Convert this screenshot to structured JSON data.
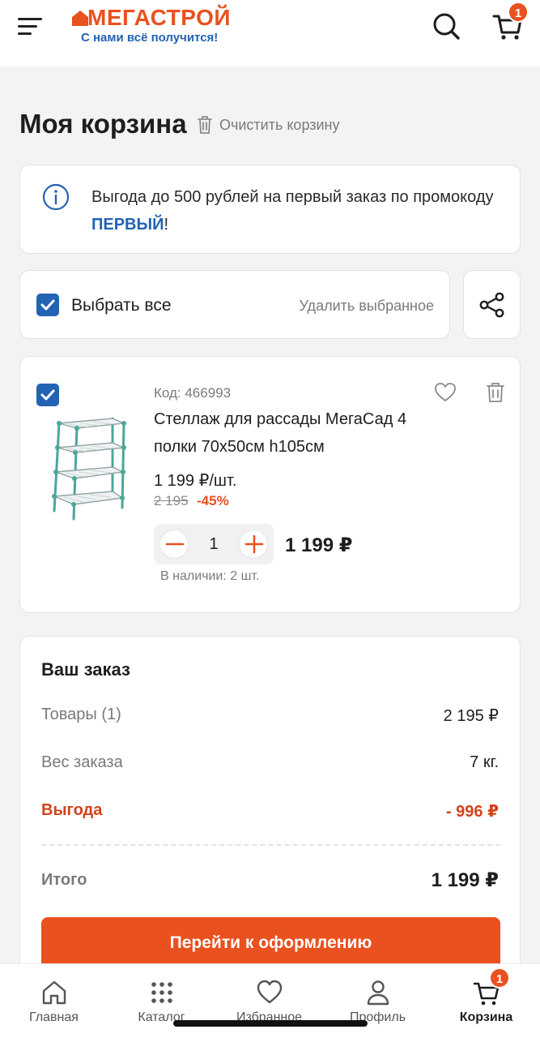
{
  "header": {
    "logo_name": "МЕГАСТРОЙ",
    "logo_tagline": "С нами всё получится!",
    "cart_count": "1",
    "brand_color": "#e9511f",
    "accent_color": "#2363b3"
  },
  "page": {
    "title": "Моя корзина",
    "clear_cart_label": "Очистить корзину"
  },
  "promo": {
    "text_before": "Выгода до 500 рублей на первый заказ по промокоду ",
    "code": "ПЕРВЫЙ",
    "text_after": "!"
  },
  "selection": {
    "select_all_label": "Выбрать все",
    "select_all_checked": true,
    "delete_selected_label": "Удалить выбранное"
  },
  "items": [
    {
      "checked": true,
      "code": "Код: 466993",
      "name": "Стеллаж для рассады МегаСад 4 полки 70х50см h105см",
      "unit_price": "1 199 ₽/шт.",
      "old_price": "2 195",
      "discount": "-45%",
      "quantity": "1",
      "line_total": "1 199 ₽",
      "stock": "В наличии: 2 шт."
    }
  ],
  "order": {
    "title": "Ваш заказ",
    "goods_label": "Товары (1)",
    "goods_value": "2 195 ₽",
    "weight_label": "Вес заказа",
    "weight_value": "7 кг.",
    "benefit_label": "Выгода",
    "benefit_value": "- 996 ₽",
    "total_label": "Итого",
    "total_value": "1 199 ₽",
    "checkout_label": "Перейти к оформлению"
  },
  "tabbar": {
    "items": [
      {
        "label": "Главная",
        "icon": "home-icon"
      },
      {
        "label": "Каталог",
        "icon": "grid-icon"
      },
      {
        "label": "Избранное",
        "icon": "heart-icon"
      },
      {
        "label": "Профиль",
        "icon": "profile-icon"
      },
      {
        "label": "Корзина",
        "icon": "cart-icon",
        "active": true,
        "badge": "1"
      }
    ]
  }
}
